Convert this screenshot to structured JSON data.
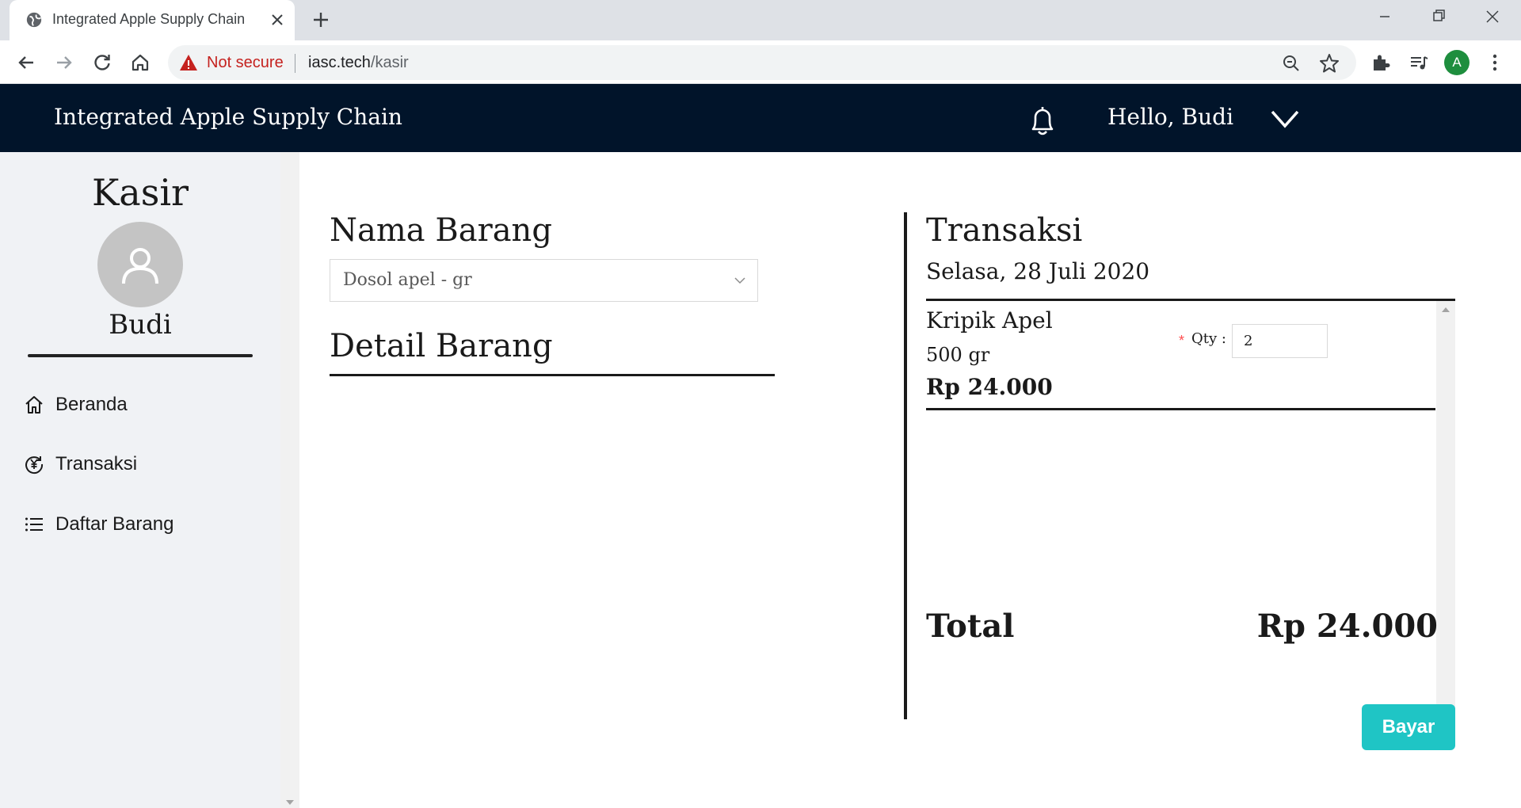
{
  "browser": {
    "tab_title": "Integrated Apple Supply Chain",
    "security_label": "Not secure",
    "url_host": "iasc.tech",
    "url_path": "/kasir",
    "profile_initial": "A"
  },
  "header": {
    "brand": "Integrated Apple Supply Chain",
    "greeting": "Hello, Budi"
  },
  "sidebar": {
    "role": "Kasir",
    "user_name": "Budi",
    "items": [
      {
        "label": "Beranda",
        "icon": "home-icon"
      },
      {
        "label": "Transaksi",
        "icon": "transaction-icon"
      },
      {
        "label": "Daftar Barang",
        "icon": "list-icon"
      }
    ]
  },
  "main": {
    "page_title": "Transaksi",
    "nama_barang_label": "Nama Barang",
    "selected_item": "Dosol apel - gr",
    "detail_label": "Detail Barang",
    "transaction": {
      "title": "Transaksi",
      "date": "Selasa, 28 Juli 2020",
      "items": [
        {
          "name": "Kripik Apel",
          "weight": "500 gr",
          "price": "Rp 24.000",
          "qty_label": "Qty",
          "qty": "2"
        }
      ],
      "total_label": "Total",
      "total_value": "Rp 24.000",
      "pay_label": "Bayar"
    }
  },
  "colors": {
    "header_bg": "#01142a",
    "sidebar_bg": "#f0f2f5",
    "pay_button": "#1fc5c5",
    "warning": "#c5221f"
  }
}
